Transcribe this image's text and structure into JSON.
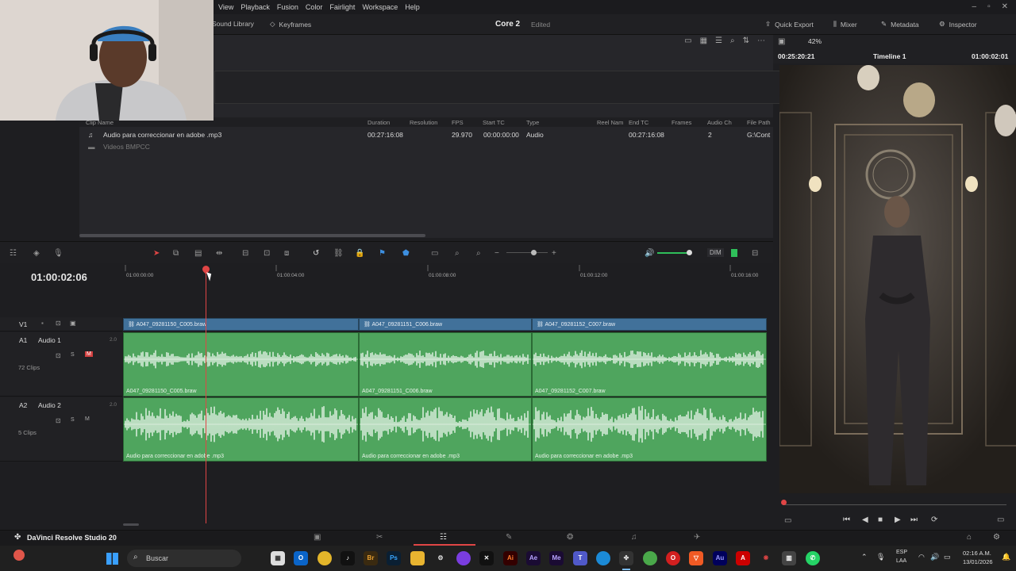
{
  "menu": [
    "View",
    "Playback",
    "Fusion",
    "Color",
    "Fairlight",
    "Workspace",
    "Help"
  ],
  "toolbar": {
    "sound_library": "Sound Library",
    "keyframes": "Keyframes",
    "project_name": "Core 2",
    "project_status": "Edited",
    "quick_export": "Quick Export",
    "mixer": "Mixer",
    "metadata": "Metadata",
    "inspector": "Inspector"
  },
  "media_pool": {
    "columns": [
      "Clip Name",
      "Duration",
      "Resolution",
      "FPS",
      "Start TC",
      "Type",
      "Reel Nam",
      "End TC",
      "Frames",
      "Audio Ch",
      "File Path"
    ],
    "rows": [
      {
        "name": "Audio para correccionar en adobe .mp3",
        "duration": "00:27:16:08",
        "fps": "29.970",
        "start_tc": "00:00:00:00",
        "type": "Audio",
        "end_tc": "00:27:16:08",
        "audio_ch": "2",
        "path": "G:\\Cont"
      },
      {
        "name": "Videos BMPCC"
      }
    ]
  },
  "viewer": {
    "zoom": "42%",
    "source_tc": "00:25:20:21",
    "timeline_name": "Timeline 1",
    "record_tc": "01:00:02:01"
  },
  "timeline": {
    "timecode": "01:00:02:06",
    "dim_label": "DIM",
    "ruler": [
      "01:00:00:00",
      "01:00:04:00",
      "01:00:08:00",
      "01:00:12:00",
      "01:00:16:00"
    ],
    "tracks": [
      {
        "id": "V1",
        "name": "",
        "clips": [
          "A047_09281150_C005.braw",
          "A047_09281151_C006.braw",
          "A047_09281152_C007.braw"
        ]
      },
      {
        "id": "A1",
        "name": "Audio 1",
        "level": "2.0",
        "count": "72 Clips",
        "clips": [
          "A047_09281150_C005.braw",
          "A047_09281151_C006.braw",
          "A047_09281152_C007.braw"
        ]
      },
      {
        "id": "A2",
        "name": "Audio 2",
        "level": "2.0",
        "count": "5 Clips",
        "clips": [
          "Audio para correccionar en adobe .mp3",
          "Audio para correccionar en adobe .mp3",
          "Audio para correccionar en adobe .mp3"
        ]
      }
    ]
  },
  "app_name": "DaVinci Resolve Studio 20",
  "taskbar": {
    "search_placeholder": "Buscar",
    "lang": "ESP",
    "lang2": "LAA",
    "time": "02:16 A.M.",
    "date": "13/01/2026"
  },
  "colors": {
    "video_clip": "#41719a",
    "audio_clip": "#4fa55e",
    "playhead": "#e04545"
  }
}
